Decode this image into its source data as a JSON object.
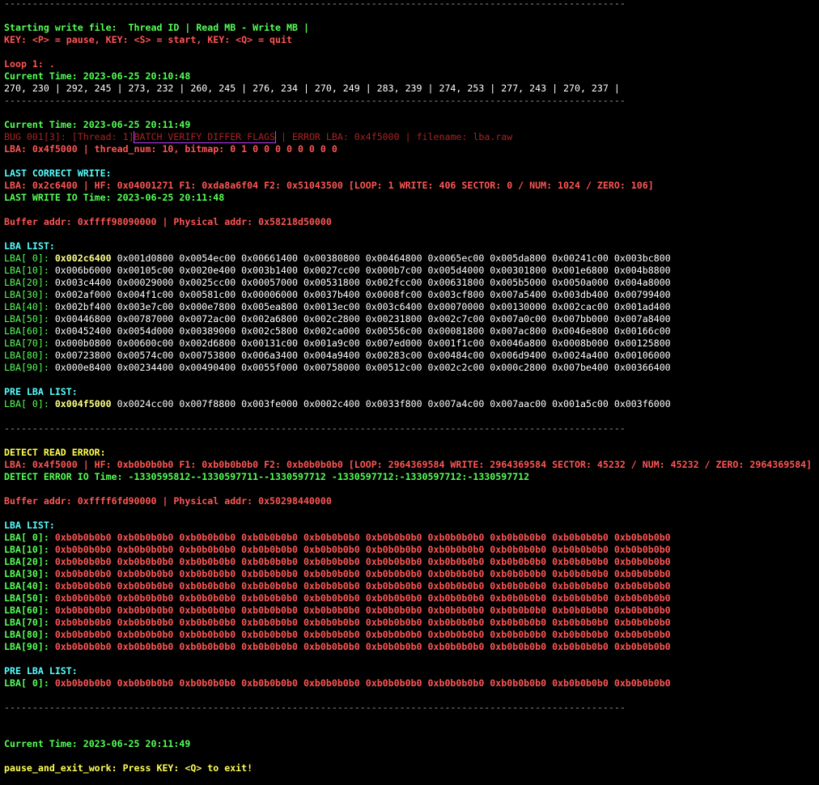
{
  "separator": "--------------------------------------------------------------------------------------------------------------",
  "header": {
    "starting": "Starting write file:  Thread ID | Read MB - Write MB |",
    "keys": "KEY: <P> = pause, KEY: <S> = start, KEY: <Q> = quit"
  },
  "loop1": {
    "label": "Loop 1: .",
    "time": "Current Time: 2023-06-25 20:10:48",
    "stats": "270, 230 | 292, 245 | 273, 232 | 260, 245 | 276, 234 | 270, 249 | 283, 239 | 274, 253 | 277, 243 | 270, 237 |"
  },
  "bug": {
    "time": "Current Time: 2023-06-25 20:11:49",
    "prefix": "BUG 001[3]: [Thread: 1]",
    "flag": "BATCH VERIFY DIFFER FLAGS",
    "suffix": "| ERROR LBA: 0x4f5000 | filename: lba.raw",
    "lba_line": "LBA: 0x4f5000 | thread_num: 10, bitmap: 0 1 0 0 0 0 0 0 0 0"
  },
  "last_correct": {
    "title": "LAST CORRECT WRITE:",
    "line": "LBA: 0x2c6400 | HF: 0x04001271 F1: 0xda8a6f04 F2: 0x51043500 [LOOP: 1 WRITE: 406 SECTOR: 0 / NUM: 1024 / ZERO: 106]",
    "io_time": "LAST WRITE IO Time: 2023-06-25 20:11:48",
    "buffer": "Buffer addr: 0xffff98090000 | Physical addr: 0x58218d50000",
    "lba_title": "LBA LIST:",
    "lba_rows": [
      {
        "label": "LBA[ 0]:",
        "first": "0x002c6400",
        "rest": "0x001d0800 0x0054ec00 0x00661400 0x00380800 0x00464800 0x0065ec00 0x005da800 0x00241c00 0x003bc800"
      },
      {
        "label": "LBA[10]:",
        "first": "",
        "rest": "0x006b6000 0x00105c00 0x0020e400 0x003b1400 0x0027cc00 0x000b7c00 0x005d4000 0x00301800 0x001e6800 0x004b8800"
      },
      {
        "label": "LBA[20]:",
        "first": "",
        "rest": "0x003c4400 0x00029000 0x0025cc00 0x00057000 0x00531800 0x002fcc00 0x00631800 0x005b5000 0x0050a000 0x004a8000"
      },
      {
        "label": "LBA[30]:",
        "first": "",
        "rest": "0x002af000 0x004f1c00 0x00581c00 0x00006000 0x0037b400 0x0008fc00 0x003cf800 0x007a5400 0x003db400 0x00799400"
      },
      {
        "label": "LBA[40]:",
        "first": "",
        "rest": "0x002bf400 0x003e7c00 0x000e7800 0x005ea800 0x0013ec00 0x003c6400 0x00070000 0x00130000 0x002cac00 0x001ad400"
      },
      {
        "label": "LBA[50]:",
        "first": "",
        "rest": "0x00446800 0x00787000 0x0072ac00 0x002a6800 0x002c2800 0x00231800 0x002c7c00 0x007a0c00 0x007bb000 0x007a8400"
      },
      {
        "label": "LBA[60]:",
        "first": "",
        "rest": "0x00452400 0x0054d000 0x00389000 0x002c5800 0x002ca000 0x00556c00 0x00081800 0x007ac800 0x0046e800 0x00166c00"
      },
      {
        "label": "LBA[70]:",
        "first": "",
        "rest": "0x000b0800 0x00600c00 0x002d6800 0x00131c00 0x001a9c00 0x007ed000 0x001f1c00 0x0046a800 0x0008b000 0x00125800"
      },
      {
        "label": "LBA[80]:",
        "first": "",
        "rest": "0x00723800 0x00574c00 0x00753800 0x006a3400 0x004a9400 0x00283c00 0x00484c00 0x006d9400 0x0024a400 0x00106000"
      },
      {
        "label": "LBA[90]:",
        "first": "",
        "rest": "0x000e8400 0x00234400 0x00490400 0x0055f000 0x00758000 0x00512c00 0x002c2c00 0x000c2800 0x007be400 0x00366400"
      }
    ],
    "pre_title": "PRE LBA LIST:",
    "pre_row": {
      "label": "LBA[ 0]:",
      "first": "0x004f5000",
      "rest": "0x0024cc00 0x007f8800 0x003fe000 0x0002c400 0x0033f800 0x007a4c00 0x007aac00 0x001a5c00 0x003f6000"
    }
  },
  "detect": {
    "title": "DETECT READ ERROR:",
    "line": "LBA: 0x4f5000 | HF: 0xb0b0b0b0 F1: 0xb0b0b0b0 F2: 0xb0b0b0b0 [LOOP: 2964369584 WRITE: 2964369584 SECTOR: 45232 / NUM: 45232 / ZERO: 2964369584]",
    "io_time": "DETECT ERROR IO Time: -1330595812--1330597711--1330597712 -1330597712:-1330597712:-1330597712",
    "buffer": "Buffer addr: 0xffff6fd90000 | Physical addr: 0x50298440000",
    "lba_title": "LBA LIST:",
    "lba_labels": [
      "LBA[ 0]:",
      "LBA[10]:",
      "LBA[20]:",
      "LBA[30]:",
      "LBA[40]:",
      "LBA[50]:",
      "LBA[60]:",
      "LBA[70]:",
      "LBA[80]:",
      "LBA[90]:"
    ],
    "lba_value_row": "0xb0b0b0b0 0xb0b0b0b0 0xb0b0b0b0 0xb0b0b0b0 0xb0b0b0b0 0xb0b0b0b0 0xb0b0b0b0 0xb0b0b0b0 0xb0b0b0b0 0xb0b0b0b0",
    "pre_title": "PRE LBA LIST:",
    "pre_label": "LBA[ 0]:"
  },
  "footer": {
    "time": "Current Time: 2023-06-25 20:11:49",
    "exit": "pause_and_exit_work: Press KEY: <Q> to exit!"
  },
  "colors": {
    "background": "#000000",
    "green": "#55ff55",
    "red": "#ff5555",
    "cyan": "#55ffff",
    "yellow": "#ffff55",
    "separator": "#9a9a9a",
    "flag_box": "#c040ff"
  }
}
